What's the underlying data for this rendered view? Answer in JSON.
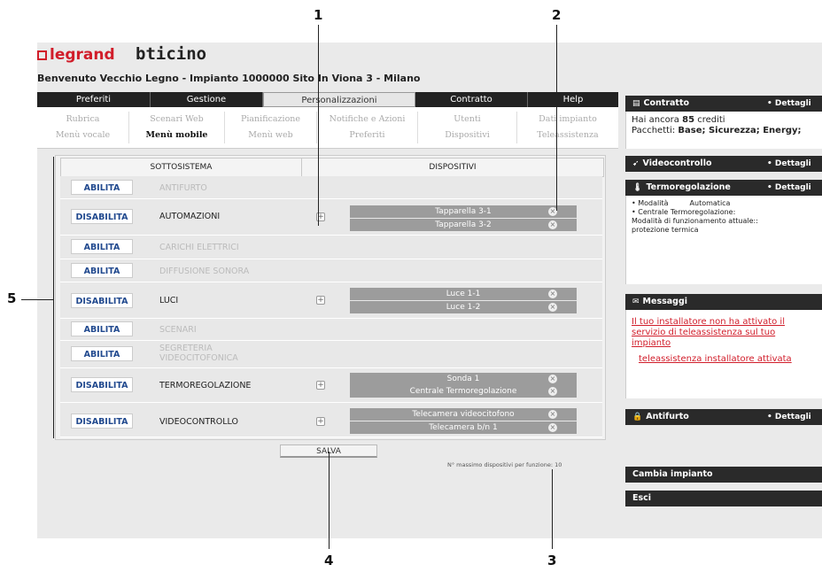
{
  "brand": {
    "legrand": "legrand",
    "bticino": "bticino"
  },
  "welcome": "Benvenuto Vecchio Legno - Impianto 1000000 Sito In Viona 3 - Milano",
  "tabs": [
    "Preferiti",
    "Gestione",
    "Personalizzazioni",
    "Contratto",
    "Help"
  ],
  "subnav": {
    "row1": [
      "Rubrica",
      "Scenari Web",
      "Pianificazione",
      "Notifiche e Azioni",
      "Utenti",
      "Dati impianto"
    ],
    "row2": [
      "Menù vocale",
      "Menù mobile",
      "Menù web",
      "Preferiti",
      "Dispositivi",
      "Teleassistenza"
    ]
  },
  "table": {
    "col1": "SOTTOSISTEMA",
    "col2": "DISPOSITIVI"
  },
  "rows": [
    {
      "button": "ABILITA",
      "name": "ANTIFURTO",
      "devices": []
    },
    {
      "button": "DISABILITA",
      "name": "AUTOMAZIONI",
      "devices": [
        "Tapparella 3-1",
        "Tapparella 3-2"
      ]
    },
    {
      "button": "ABILITA",
      "name": "CARICHI ELETTRICI",
      "devices": []
    },
    {
      "button": "ABILITA",
      "name": "DIFFUSIONE SONORA",
      "devices": []
    },
    {
      "button": "DISABILITA",
      "name": "LUCI",
      "devices": [
        "Luce 1-1",
        "Luce 1-2"
      ]
    },
    {
      "button": "ABILITA",
      "name": "SCENARI",
      "devices": []
    },
    {
      "button": "ABILITA",
      "name": "SEGRETERIA VIDEOCITOFONICA",
      "name_l1": "SEGRETERIA",
      "name_l2": "VIDEOCITOFONICA",
      "devices": []
    },
    {
      "button": "DISABILITA",
      "name": "TERMOREGOLAZIONE",
      "devices": [
        "Sonda 1",
        "Centrale Termoregolazione"
      ]
    },
    {
      "button": "DISABILITA",
      "name": "VIDEOCONTROLLO",
      "devices": [
        "Telecamera videocitofono",
        "Telecamera b/n 1"
      ]
    }
  ],
  "plus_symbol": "+",
  "remove_symbol": "×",
  "save_label": "SALVA",
  "max_note": "N° massimo dispositivi per funzione: 10",
  "sidebar": {
    "contratto": {
      "title": "Contratto",
      "details": "• Dettagli",
      "credits_prefix": "Hai ancora ",
      "credits": "85",
      "credits_suffix": " crediti",
      "packages_label": "Pacchetti: ",
      "packages": "Base; Sicurezza; Energy;"
    },
    "videocontrollo": {
      "title": "Videocontrollo",
      "details": "• Dettagli"
    },
    "termoregolazione": {
      "title": "Termoregolazione",
      "details": "• Dettagli",
      "line1a": "• Modalità",
      "line1b": "Automatica",
      "line2": "• Centrale Termoregolazione:",
      "line3": "Modalità di funzionamento attuale::",
      "line4": "protezione termica"
    },
    "messaggi": {
      "title": "Messaggi",
      "msg1": "Il tuo installatore non ha attivato il servizio di teleassistenza sul tuo impianto",
      "msg2": "teleassistenza installatore attivata"
    },
    "antifurto": {
      "title": "Antifurto",
      "details": "• Dettagli"
    },
    "cambia": "Cambia impianto",
    "esci": "Esci"
  },
  "callouts": [
    "1",
    "2",
    "3",
    "4",
    "5"
  ],
  "colors": {
    "accent_button_text": "#224a8f",
    "message_red": "#d11d2a",
    "bar_dark": "#2a2a2a"
  }
}
